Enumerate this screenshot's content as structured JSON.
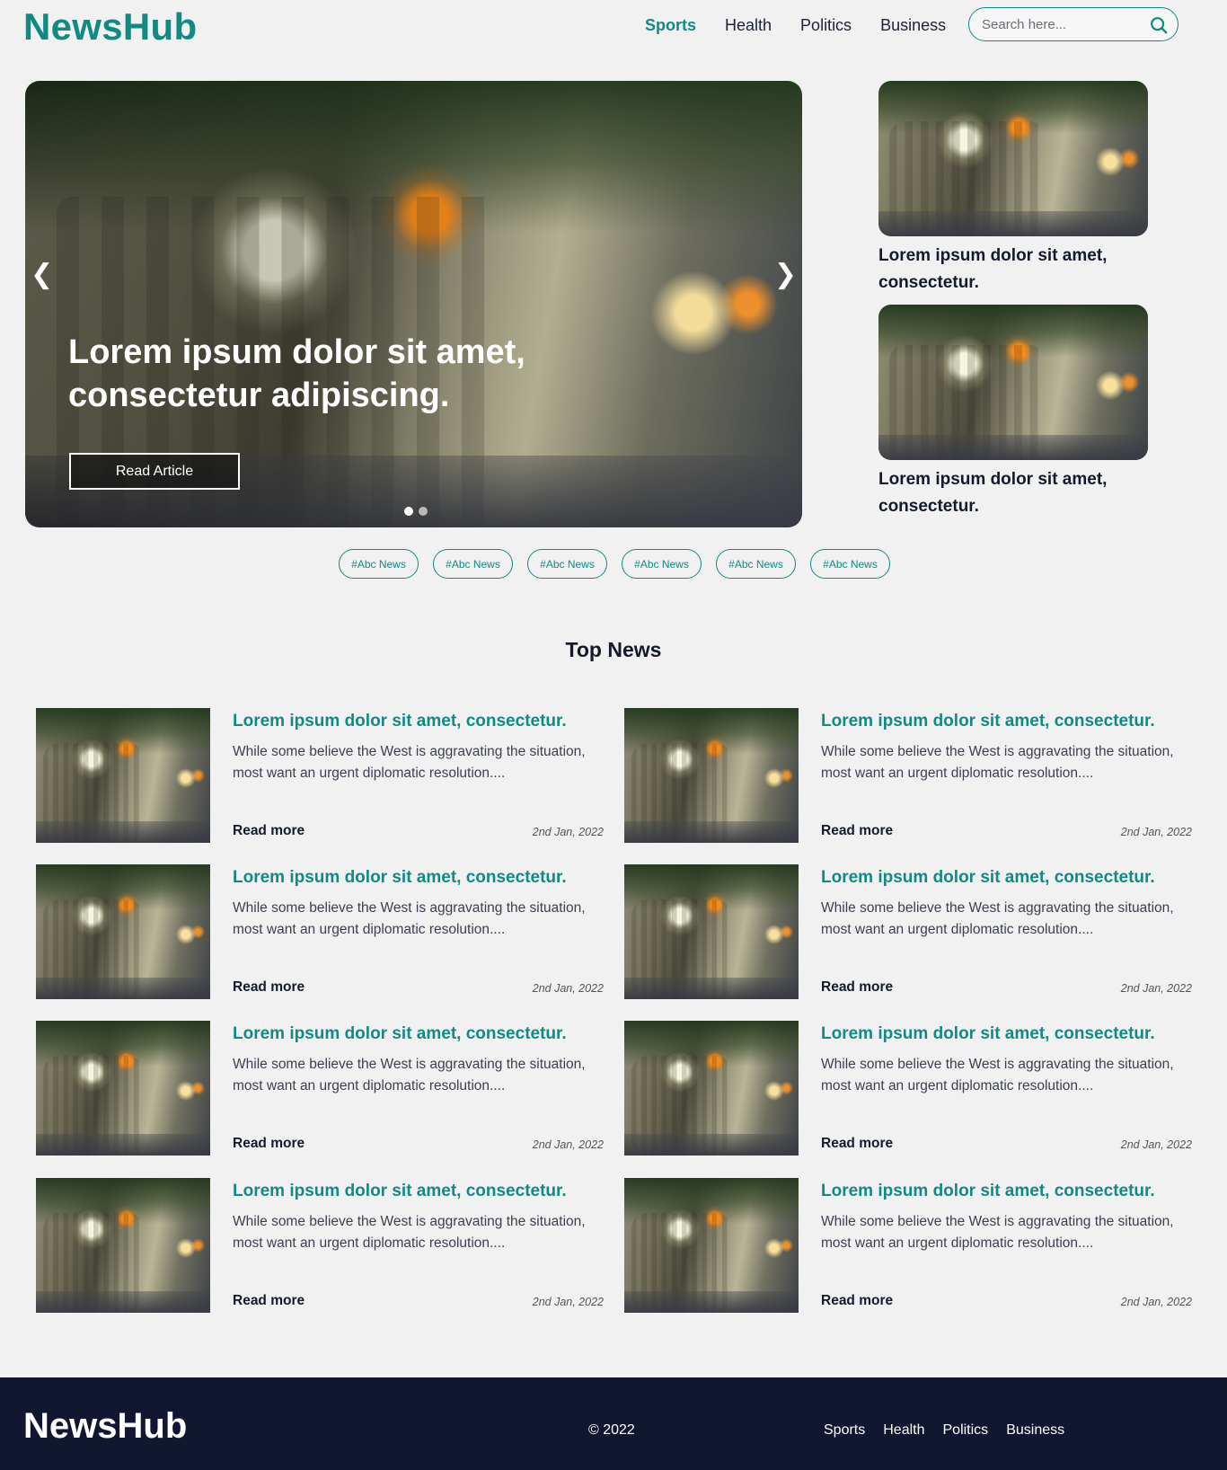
{
  "brand": {
    "logo": "NewsHub",
    "accent": "#128a84",
    "footer_bg": "#111730"
  },
  "nav": {
    "items": [
      {
        "label": "Sports",
        "active": true
      },
      {
        "label": "Health",
        "active": false
      },
      {
        "label": "Politics",
        "active": false
      },
      {
        "label": "Business",
        "active": false
      }
    ]
  },
  "search": {
    "placeholder": "Search here...",
    "icon": "search-icon"
  },
  "hero": {
    "title": "Lorem ipsum dolor sit amet, consectetur adipiscing.",
    "button_label": "Read Article",
    "prev_symbol": "❮",
    "next_symbol": "❯",
    "slides": 2,
    "active_slide": 1
  },
  "side_articles": [
    {
      "caption": "Lorem ipsum dolor sit amet, consectetur."
    },
    {
      "caption": "Lorem ipsum dolor sit amet, consectetur."
    }
  ],
  "tags": [
    "#Abc News",
    "#Abc News",
    "#Abc News",
    "#Abc News",
    "#Abc News",
    "#Abc News"
  ],
  "top_news": {
    "title": "Top News",
    "items": [
      {
        "title": "Lorem ipsum dolor sit amet, consectetur.",
        "desc": "While some believe the West is aggravating the situation, most want an urgent diplomatic resolution....",
        "more": "Read more",
        "date": "2nd Jan, 2022"
      },
      {
        "title": "Lorem ipsum dolor sit amet, consectetur.",
        "desc": "While some believe the West is aggravating the situation, most want an urgent diplomatic resolution....",
        "more": "Read more",
        "date": "2nd Jan, 2022"
      },
      {
        "title": "Lorem ipsum dolor sit amet, consectetur.",
        "desc": "While some believe the West is aggravating the situation, most want an urgent diplomatic resolution....",
        "more": "Read more",
        "date": "2nd Jan, 2022"
      },
      {
        "title": "Lorem ipsum dolor sit amet, consectetur.",
        "desc": "While some believe the West is aggravating the situation, most want an urgent diplomatic resolution....",
        "more": "Read more",
        "date": "2nd Jan, 2022"
      },
      {
        "title": "Lorem ipsum dolor sit amet, consectetur.",
        "desc": "While some believe the West is aggravating the situation, most want an urgent diplomatic resolution....",
        "more": "Read more",
        "date": "2nd Jan, 2022"
      },
      {
        "title": "Lorem ipsum dolor sit amet, consectetur.",
        "desc": "While some believe the West is aggravating the situation, most want an urgent diplomatic resolution....",
        "more": "Read more",
        "date": "2nd Jan, 2022"
      },
      {
        "title": "Lorem ipsum dolor sit amet, consectetur.",
        "desc": "While some believe the West is aggravating the situation, most want an urgent diplomatic resolution....",
        "more": "Read more",
        "date": "2nd Jan, 2022"
      },
      {
        "title": "Lorem ipsum dolor sit amet, consectetur.",
        "desc": "While some believe the West is aggravating the situation, most want an urgent diplomatic resolution....",
        "more": "Read more",
        "date": "2nd Jan, 2022"
      }
    ]
  },
  "footer": {
    "logo": "NewsHub",
    "copyright": "© 2022",
    "links": [
      "Sports",
      "Health",
      "Politics",
      "Business"
    ]
  }
}
